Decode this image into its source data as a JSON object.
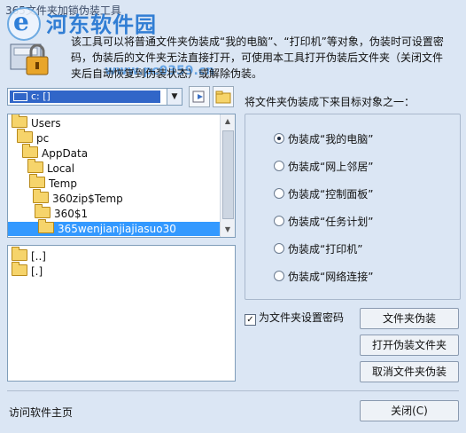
{
  "window": {
    "title": "365文件夹加锁伪装工具"
  },
  "watermark": {
    "site_name": "河东软件园",
    "url": "www.pc0359.cn"
  },
  "description": "该工具可以将普通文件夹伪装成“我的电脑”、“打印机”等对象，伪装时可设置密码，伪装后的文件夹无法直接打开，可使用本工具打开伪装后文件夹（关闭文件夹后自动恢复到伪装状态）或解除伪装。",
  "drive": {
    "selected": "c: []"
  },
  "tree": {
    "items": [
      {
        "label": "Users"
      },
      {
        "label": "pc"
      },
      {
        "label": "AppData"
      },
      {
        "label": "Local"
      },
      {
        "label": "Temp"
      },
      {
        "label": "360zip$Temp"
      },
      {
        "label": "360$1"
      },
      {
        "label": "365wenjianjiajiasuo30"
      }
    ]
  },
  "files": [
    {
      "label": "[..]"
    },
    {
      "label": "[.]"
    }
  ],
  "disguise": {
    "label": "将文件夹伪装成下来目标对象之一：",
    "options": [
      {
        "label": "伪装成“我的电脑”",
        "selected": true
      },
      {
        "label": "伪装成“网上邻居”",
        "selected": false
      },
      {
        "label": "伪装成“控制面板”",
        "selected": false
      },
      {
        "label": "伪装成“任务计划”",
        "selected": false
      },
      {
        "label": "伪装成“打印机”",
        "selected": false
      },
      {
        "label": "伪装成“网络连接”",
        "selected": false
      }
    ]
  },
  "password": {
    "label": "为文件夹设置密码",
    "checked": true
  },
  "buttons": {
    "disguise": "文件夹伪装",
    "open": "打开伪装文件夹",
    "cancel": "取消文件夹伪装",
    "close": "关闭(C)"
  },
  "footer": {
    "home_link": "访问软件主页"
  },
  "colors": {
    "background": "#dbe6f4",
    "selection": "#3399ff",
    "drive_highlight": "#3166c8"
  }
}
